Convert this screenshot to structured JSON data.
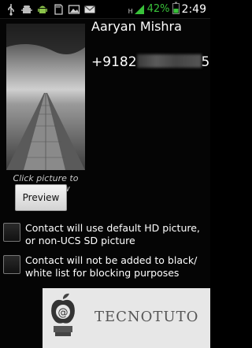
{
  "status_bar": {
    "left_icons": [
      "usb-icon",
      "android-debug-icon",
      "android-icon",
      "sd-card-icon",
      "image-icon",
      "gmail-icon"
    ],
    "network": "H",
    "battery_percent": "42%",
    "time": "2:49"
  },
  "contact": {
    "name": "Aaryan Mishra",
    "phone_prefix": "+9182",
    "phone_suffix": "5"
  },
  "photo": {
    "caption": "Click picture to assign new"
  },
  "preview_button": {
    "label": "Preview"
  },
  "options": [
    {
      "label": "Contact will use default HD picture, or non-UCS SD picture",
      "checked": false
    },
    {
      "label": "Contact will not be added to black/ white list for blocking purposes",
      "checked": false
    }
  ],
  "watermark": {
    "text": "TECNOTUTO"
  }
}
